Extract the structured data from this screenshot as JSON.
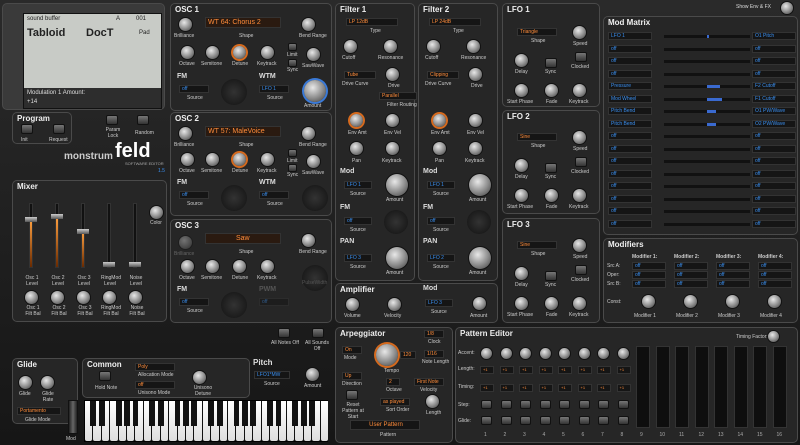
{
  "display": {
    "patch_name": "sound buffer",
    "bank": "A",
    "number": "001",
    "line1": "Tabloid",
    "line2": "DocT",
    "category": "Pad",
    "param": "Modulation 1 Amount:",
    "value": "+14"
  },
  "program": {
    "title": "Program",
    "init": "Init",
    "request": "Request",
    "param_lock": "Param Lock",
    "random": "Random"
  },
  "brand": {
    "prefix": "monstrum",
    "name": "feld",
    "subtitle": "SOFTWARE EDITOR",
    "version": "1.5"
  },
  "show_env": "Show Env & FX",
  "osc1": {
    "title": "OSC 1",
    "shape": "WT 64: Chorus 2",
    "brilliance": "Brilliance",
    "shape_lbl": "Shape",
    "bend_range": "Bend Range",
    "octave": "Octave",
    "semitone": "Semitone",
    "detune": "Detune",
    "keytrack": "Keytrack",
    "limit": "Limit",
    "sync": "Sync",
    "sawwave": "SawWave",
    "fm": "FM",
    "wtm": "WTM",
    "fm_src": "off",
    "wtm_src": "LFO 1",
    "source": "Source",
    "amount": "Amount"
  },
  "osc2": {
    "title": "OSC 2",
    "shape": "WT 57: MaleVoice",
    "brilliance": "Brilliance",
    "shape_lbl": "Shape",
    "bend_range": "Bend Range",
    "octave": "Octave",
    "semitone": "Semitone",
    "detune": "Detune",
    "keytrack": "Keytrack",
    "limit": "Limit",
    "sync": "Sync",
    "sawwave": "SawWave",
    "fm": "FM",
    "wtm": "WTM",
    "fm_src": "off",
    "wtm_src": "off",
    "source": "Source",
    "amount": "Amount"
  },
  "osc3": {
    "title": "OSC 3",
    "shape": "Saw",
    "brilliance": "Brilliance",
    "shape_lbl": "Shape",
    "bend_range": "Bend Range",
    "octave": "Octave",
    "semitone": "Semitone",
    "detune": "Detune",
    "keytrack": "Keytrack",
    "fm": "FM",
    "pwm": "PWM",
    "fm_src": "off",
    "pwm_src": "off",
    "source": "Source",
    "amount": "Amount",
    "pulsewidth": "PulseWidth"
  },
  "filter1": {
    "title": "Filter 1",
    "type": "LP 12dB",
    "type_lbl": "Type",
    "cutoff": "Cutoff",
    "resonance": "Resonance",
    "drive_curve": "Tube",
    "drive_curve_lbl": "Drive Curve",
    "drive": "Drive",
    "env_amt": "Env Amt",
    "env_vel": "Env Vel",
    "pan": "Pan",
    "keytrack": "Keytrack"
  },
  "filter2": {
    "title": "Filter 2",
    "type": "LP 24dB",
    "type_lbl": "Type",
    "cutoff": "Cutoff",
    "resonance": "Resonance",
    "drive_curve": "Clipping",
    "drive_curve_lbl": "Drive Curve",
    "drive": "Drive",
    "env_amt": "Env Amt",
    "env_vel": "Env Vel",
    "pan": "Pan",
    "keytrack": "Keytrack"
  },
  "routing": {
    "value": "Parallel",
    "label": "Filter Routing"
  },
  "fmod": {
    "mod": "Mod",
    "fm": "FM",
    "pan": "PAN",
    "lfo1": "LFO 1",
    "off": "off",
    "lfo3": "LFO 3",
    "lfo2": "LFO 2",
    "source": "Source",
    "amount": "Amount"
  },
  "amplifier": {
    "title": "Amplifier",
    "volume": "Volume",
    "velocity": "Velocity",
    "mod": "Mod",
    "src": "LFO 3",
    "source": "Source",
    "amount": "Amount"
  },
  "lfo1": {
    "title": "LFO 1",
    "shape": "Triangle",
    "shape_lbl": "Shape",
    "speed": "Speed",
    "delay": "Delay",
    "sync": "Sync",
    "clocked": "Clocked",
    "start_phase": "Start Phase",
    "fade": "Fade",
    "keytrack": "Keytrack"
  },
  "lfo2": {
    "title": "LFO 2",
    "shape": "Sine",
    "shape_lbl": "Shape",
    "speed": "Speed",
    "delay": "Delay",
    "sync": "Sync",
    "clocked": "Clocked",
    "start_phase": "Start Phase",
    "fade": "Fade",
    "keytrack": "Keytrack"
  },
  "lfo3": {
    "title": "LFO 3",
    "shape": "Sine",
    "shape_lbl": "Shape",
    "speed": "Speed",
    "delay": "Delay",
    "sync": "Sync",
    "clocked": "Clocked",
    "start_phase": "Start Phase",
    "fade": "Fade",
    "keytrack": "Keytrack"
  },
  "modmatrix": {
    "title": "Mod Matrix",
    "rows": [
      {
        "src": "LFO 1",
        "dst": "O1 Pitch",
        "amt": 0.05
      },
      {
        "src": "off",
        "dst": "off",
        "amt": 0
      },
      {
        "src": "off",
        "dst": "off",
        "amt": 0
      },
      {
        "src": "off",
        "dst": "off",
        "amt": 0
      },
      {
        "src": "Pressure",
        "dst": "F2 Cutoff",
        "amt": 0.3
      },
      {
        "src": "Mod Wheel",
        "dst": "F1 Cutoff",
        "amt": 0.35
      },
      {
        "src": "Pitch Bend",
        "dst": "O1 PW/Wave",
        "amt": 0.2
      },
      {
        "src": "Pitch Bend",
        "dst": "O2 PW/Wave",
        "amt": 0.22
      },
      {
        "src": "off",
        "dst": "off",
        "amt": 0
      },
      {
        "src": "off",
        "dst": "off",
        "amt": 0
      },
      {
        "src": "off",
        "dst": "off",
        "amt": 0
      },
      {
        "src": "off",
        "dst": "off",
        "amt": 0
      },
      {
        "src": "off",
        "dst": "off",
        "amt": 0
      },
      {
        "src": "off",
        "dst": "off",
        "amt": 0
      },
      {
        "src": "off",
        "dst": "off",
        "amt": 0
      },
      {
        "src": "off",
        "dst": "off",
        "amt": 0
      }
    ]
  },
  "modifiers": {
    "title": "Modifiers",
    "names": [
      "Modifier 1:",
      "Modifier 2:",
      "Modifier 3:",
      "Modifier 4:"
    ],
    "src_a": "Src A:",
    "oper": "Oper:",
    "src_b": "Src B:",
    "const": "Const:",
    "off": "off",
    "knobs": [
      "Modifier 1",
      "Modifier 2",
      "Modifier 3",
      "Modifier 4"
    ]
  },
  "mixer": {
    "title": "Mixer",
    "color": "Color",
    "channels": [
      {
        "name": "Osc 1 Level",
        "filt": "Osc 1 Filt Bal",
        "lvl": 0.75
      },
      {
        "name": "Osc 2 Level",
        "filt": "Osc 2 Filt Bal",
        "lvl": 0.8
      },
      {
        "name": "Osc 3 Level",
        "filt": "Osc 3 Filt Bal",
        "lvl": 0.55
      },
      {
        "name": "RingMod Level",
        "filt": "RingMod Filt Bal",
        "lvl": 0
      },
      {
        "name": "Noise Level",
        "filt": "Noise Filt Bal",
        "lvl": 0
      }
    ]
  },
  "glide": {
    "title": "Glide",
    "glide": "Glide",
    "rate": "Glide Rate",
    "mode": "Portamento",
    "mode_lbl": "Glide Mode"
  },
  "common": {
    "title": "Common",
    "hold": "Hold Note",
    "alloc": "Poly",
    "alloc_lbl": "Allocation Mode",
    "unison": "off",
    "unison_lbl": "Unisono Mode",
    "unison_detune": "Unisono Detune",
    "mod": "Mod"
  },
  "pitch": {
    "title": "Pitch",
    "src": "LFO1*MW",
    "source": "Source",
    "amount": "Amount"
  },
  "notes": {
    "all_off": "All Notes Off",
    "sounds_off": "All Sounds Off"
  },
  "arp": {
    "title": "Arpeggiator",
    "mode": "On",
    "mode_lbl": "Mode",
    "tempo": "120",
    "tempo_lbl": "Tempo",
    "clock": "1/8",
    "clock_lbl": "Clock",
    "note_len": "1/16",
    "note_len_lbl": "Note Length",
    "direction": "Up",
    "direction_lbl": "Direction",
    "octave": "2",
    "octave_lbl": "Octave",
    "velocity": "First Note",
    "velocity_lbl": "Velocity",
    "reset": "Reset Pattern at Start",
    "sort": "as played",
    "sort_lbl": "Sort Order",
    "length": "Length",
    "pattern": "User Pattern",
    "pattern_lbl": "Pattern"
  },
  "pattern": {
    "title": "Pattern Editor",
    "timing": "Timing Factor:",
    "rows": [
      "Accent:",
      "Length:",
      "Timing:",
      "Step:",
      "Glide:"
    ],
    "steps": [
      "1",
      "2",
      "3",
      "4",
      "5",
      "6",
      "7",
      "8",
      "9",
      "10",
      "11",
      "12",
      "13",
      "14",
      "15",
      "16"
    ]
  }
}
